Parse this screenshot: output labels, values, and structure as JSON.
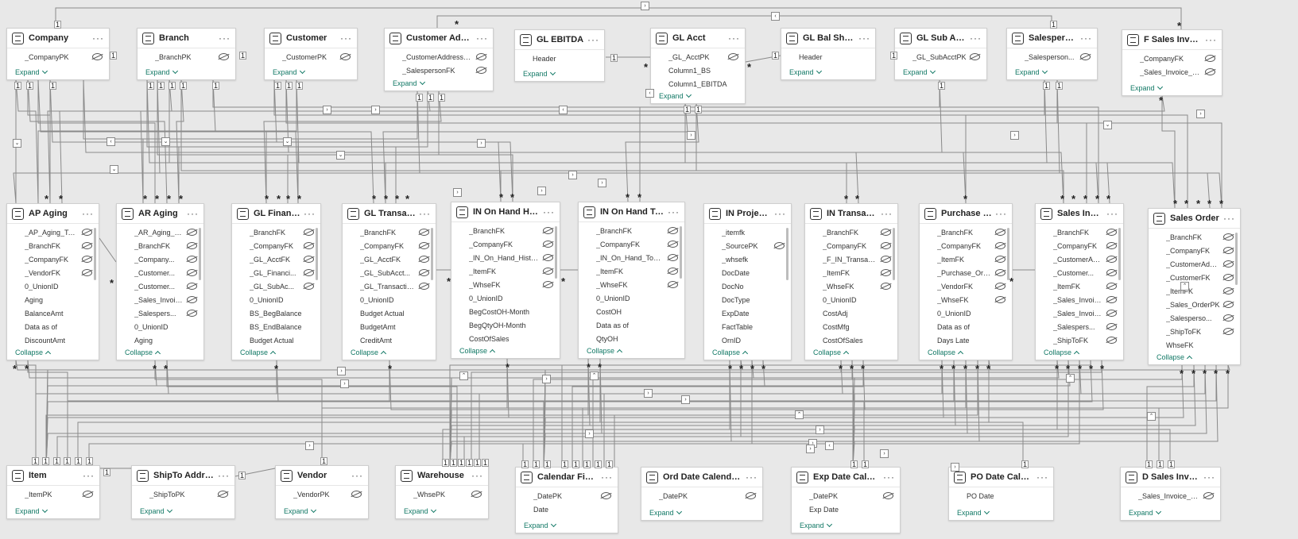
{
  "tables": [
    {
      "id": "company",
      "title": "Company",
      "fields": [
        "_CompanyPK"
      ],
      "footer": "Expand"
    },
    {
      "id": "branch",
      "title": "Branch",
      "fields": [
        "_BranchPK"
      ],
      "footer": "Expand"
    },
    {
      "id": "customer",
      "title": "Customer",
      "fields": [
        "_CustomerPK"
      ],
      "footer": "Expand"
    },
    {
      "id": "customer-address",
      "title": "Customer Address",
      "fields": [
        "_CustomerAddressPK",
        "_SalespersonFK"
      ],
      "footer": "Expand"
    },
    {
      "id": "gl-ebitda",
      "title": "GL EBITDA",
      "fields": [
        "Header"
      ],
      "footer": "Expand"
    },
    {
      "id": "gl-acct",
      "title": "GL Acct",
      "fields": [
        "_GL_AcctPK",
        "Column1_BS",
        "Column1_EBITDA"
      ],
      "footer": "Expand"
    },
    {
      "id": "gl-bal-sheet",
      "title": "GL Bal Sheet",
      "fields": [
        "Header"
      ],
      "footer": "Expand"
    },
    {
      "id": "gl-sub-acct",
      "title": "GL Sub Acct",
      "fields": [
        "_GL_SubAcctPK"
      ],
      "footer": "Expand"
    },
    {
      "id": "salesperson",
      "title": "Salesperson",
      "fields": [
        "_Salesperson..."
      ],
      "footer": "Expand"
    },
    {
      "id": "f-sales-invoice-header",
      "title": "F Sales Invoice Header",
      "fields": [
        "_CompanyFK",
        "_Sales_Invoice_HeaderFK"
      ],
      "footer": "Expand"
    },
    {
      "id": "ap-aging",
      "title": "AP Aging",
      "fields": [
        "_AP_Aging_TodayPK",
        "_BranchFK",
        "_CompanyFK",
        "_VendorFK",
        "0_UnionID",
        "Aging",
        "BalanceAmt",
        "Data as of",
        "DiscountAmt"
      ],
      "footer": "Collapse"
    },
    {
      "id": "ar-aging",
      "title": "AR Aging",
      "fields": [
        "_AR_Aging_TodayPK",
        "_BranchFK",
        "_Company...",
        "_Customer...",
        "_Customer...",
        "_Sales_Invoice_Hea...",
        "_Salespers...",
        "0_UnionID",
        "Aging"
      ],
      "footer": "Collapse"
    },
    {
      "id": "gl-financials",
      "title": "GL Financials",
      "fields": [
        "_BranchFK",
        "_CompanyFK",
        "_GL_AcctFK",
        "_GL_Financi...",
        "_GL_SubAc...",
        "0_UnionID",
        "BS_BegBalance",
        "BS_EndBalance",
        "Budget Actual"
      ],
      "footer": "Collapse"
    },
    {
      "id": "gl-transaction",
      "title": "GL Transaction",
      "fields": [
        "_BranchFK",
        "_CompanyFK",
        "_GL_AcctFK",
        "_GL_SubAcct...",
        "_GL_TransactionPK",
        "0_UnionID",
        "Budget Actual",
        "BudgetAmt",
        "CreditAmt"
      ],
      "footer": "Collapse"
    },
    {
      "id": "in-on-hand-history",
      "title": "IN On Hand History",
      "fields": [
        "_BranchFK",
        "_CompanyFK",
        "_IN_On_Hand_HistoryPK",
        "_ItemFK",
        "_WhseFK",
        "0_UnionID",
        "BegCostOH-Month",
        "BegQtyOH-Month",
        "CostOfSales"
      ],
      "footer": "Collapse"
    },
    {
      "id": "in-on-hand-today",
      "title": "IN On Hand Today",
      "fields": [
        "_BranchFK",
        "_CompanyFK",
        "_IN_On_Hand_TodayPK",
        "_ItemFK",
        "_WhseFK",
        "0_UnionID",
        "CostOH",
        "Data as of",
        "QtyOH"
      ],
      "footer": "Collapse"
    },
    {
      "id": "in-projection",
      "title": "IN Projection",
      "fields": [
        "_itemfk",
        "_SourcePK",
        "_whsefk",
        "DocDate",
        "DocNo",
        "DocType",
        "ExpDate",
        "FactTable",
        "OrnID"
      ],
      "footer": "Collapse"
    },
    {
      "id": "in-transaction",
      "title": "IN Transaction",
      "fields": [
        "_BranchFK",
        "_CompanyFK",
        "_F_IN_TransactionPK",
        "_ItemFK",
        "_WhseFK",
        "0_UnionID",
        "CostAdj",
        "CostMfg",
        "CostOfSales"
      ],
      "footer": "Collapse"
    },
    {
      "id": "purchase-order",
      "title": "Purchase Order",
      "fields": [
        "_BranchFK",
        "_CompanyFK",
        "_ItemFK",
        "_Purchase_OrderPK",
        "_VendorFK",
        "_WhseFK",
        "0_UnionID",
        "Data as of",
        "Days Late"
      ],
      "footer": "Collapse"
    },
    {
      "id": "sales-invoice",
      "title": "Sales Invoice",
      "fields": [
        "_BranchFK",
        "_CompanyFK",
        "_CustomerAddressFK",
        "_Customer...",
        "_ItemFK",
        "_Sales_Invoice_Head...",
        "_Sales_InvoicePK",
        "_Salespers...",
        "_ShipToFK"
      ],
      "footer": "Collapse"
    },
    {
      "id": "sales-order",
      "title": "Sales Order",
      "fields": [
        "_BranchFK",
        "_CompanyFK",
        "_CustomerAddressFK",
        "_CustomerFK",
        "_ItemFK",
        "_Sales_OrderPK",
        "_Salesperso...",
        "_ShipToFK",
        "WhseFK"
      ],
      "footer": "Collapse"
    },
    {
      "id": "item",
      "title": "Item",
      "fields": [
        "_ItemPK"
      ],
      "footer": "Expand"
    },
    {
      "id": "shipto-address",
      "title": "ShipTo Address",
      "fields": [
        "_ShipToPK"
      ],
      "footer": "Expand"
    },
    {
      "id": "vendor",
      "title": "Vendor",
      "fields": [
        "_VendorPK"
      ],
      "footer": "Expand"
    },
    {
      "id": "warehouse",
      "title": "Warehouse",
      "fields": [
        "_WhsePK"
      ],
      "footer": "Expand"
    },
    {
      "id": "calendar-fiscal",
      "title": "Calendar Fiscal",
      "fields": [
        "_DatePK",
        "Date"
      ],
      "footer": "Expand"
    },
    {
      "id": "ord-date-calendar-fiscal",
      "title": "Ord Date Calendar Fis...",
      "fields": [
        "_DatePK"
      ],
      "footer": "Expand"
    },
    {
      "id": "exp-date-calendar-fiscal",
      "title": "Exp Date Calendar Fiscal",
      "fields": [
        "_DatePK",
        "Exp Date"
      ],
      "footer": "Expand"
    },
    {
      "id": "po-date-calendar-fiscal",
      "title": "PO Date Calendar Fiscal",
      "fields": [
        "PO Date"
      ],
      "footer": "Expand"
    },
    {
      "id": "d-sales-invoice-header",
      "title": "D Sales Invoice Header",
      "fields": [
        "_Sales_Invoice_HeaderPK"
      ],
      "footer": "Expand"
    }
  ],
  "markers": {
    "one": "1",
    "many": "*"
  }
}
